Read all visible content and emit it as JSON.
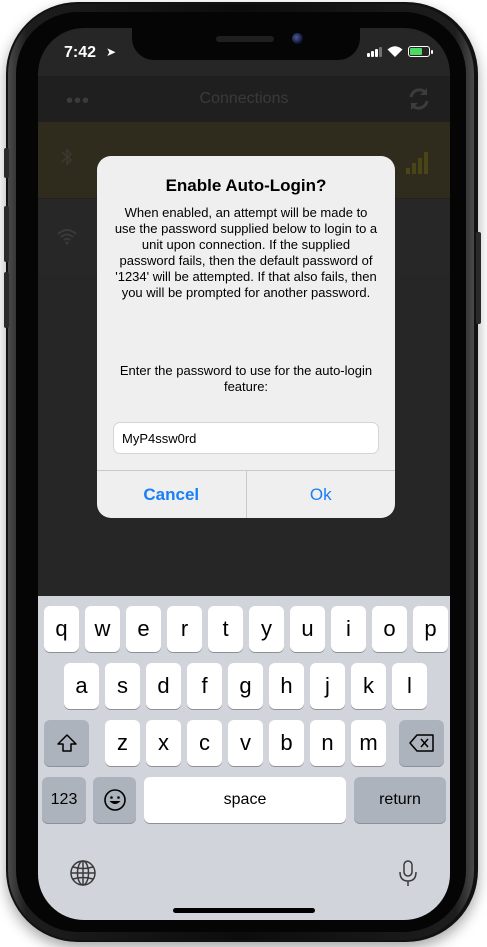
{
  "status_bar": {
    "time": "7:42"
  },
  "nav": {
    "menu": "•••",
    "title": "Connections"
  },
  "rows": [
    {
      "name": ""
    },
    {
      "name": ""
    }
  ],
  "alert": {
    "title": "Enable Auto-Login?",
    "message": "When enabled, an attempt will be made to use the password supplied below to login to a unit upon connection.  If the supplied password fails, then the default password of '1234' will be attempted.  If that also fails, then you will be prompted for another password.",
    "prompt": "Enter the password to use for the auto-login feature:",
    "input_value": "MyP4ssw0rd",
    "cancel_label": "Cancel",
    "ok_label": "Ok"
  },
  "keyboard": {
    "row1": [
      "q",
      "w",
      "e",
      "r",
      "t",
      "y",
      "u",
      "i",
      "o",
      "p"
    ],
    "row2": [
      "a",
      "s",
      "d",
      "f",
      "g",
      "h",
      "j",
      "k",
      "l"
    ],
    "row3": [
      "z",
      "x",
      "c",
      "v",
      "b",
      "n",
      "m"
    ],
    "numbers_label": "123",
    "space_label": "space",
    "return_label": "return",
    "icons": [
      "shift-icon",
      "backspace-icon",
      "emoji-icon",
      "globe-icon",
      "microphone-icon"
    ]
  },
  "colors": {
    "accent": "#1a7ff5",
    "battery": "#4cd964",
    "signal_yellow": "#4b4416"
  }
}
